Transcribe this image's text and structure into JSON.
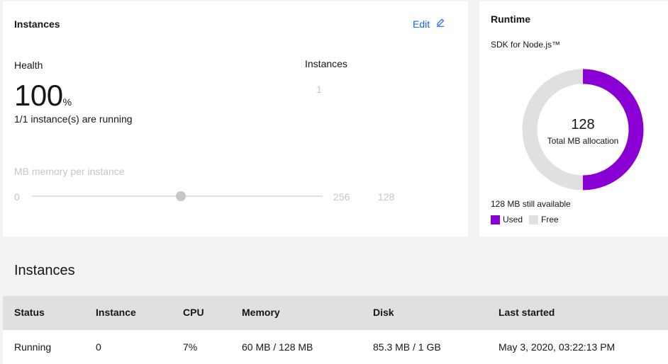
{
  "instances_card": {
    "title": "Instances",
    "edit_label": "Edit",
    "health_label": "Health",
    "health_value": "100",
    "health_unit": "%",
    "running_text": "1/1 instance(s) are running",
    "instances_label": "Instances",
    "instances_value": "1",
    "memory_label": "MB memory per instance",
    "slider_min": "0",
    "slider_max": "256",
    "memory_value": "128",
    "slider_fraction": 0.5
  },
  "runtime_card": {
    "title": "Runtime",
    "sdk_label": "SDK for Node.js™",
    "donut_value": "128",
    "donut_caption": "Total MB allocation",
    "available_text": "128 MB still available",
    "used_fraction": 0.5,
    "legend": [
      {
        "label": "Used",
        "color": "#8a00d4"
      },
      {
        "label": "Free",
        "color": "#e0e0e0"
      }
    ]
  },
  "instances_section": {
    "title": "Instances",
    "columns": [
      "Status",
      "Instance",
      "CPU",
      "Memory",
      "Disk",
      "Last started"
    ],
    "rows": [
      [
        "Running",
        "0",
        "7%",
        "60 MB / 128 MB",
        "85.3 MB / 1 GB",
        "May 3, 2020, 03:22:13 PM"
      ]
    ]
  },
  "colors": {
    "accent": "#0f62fe",
    "used": "#8a00d4",
    "free": "#e0e0e0"
  },
  "icons": {
    "edit": "pencil-icon"
  }
}
